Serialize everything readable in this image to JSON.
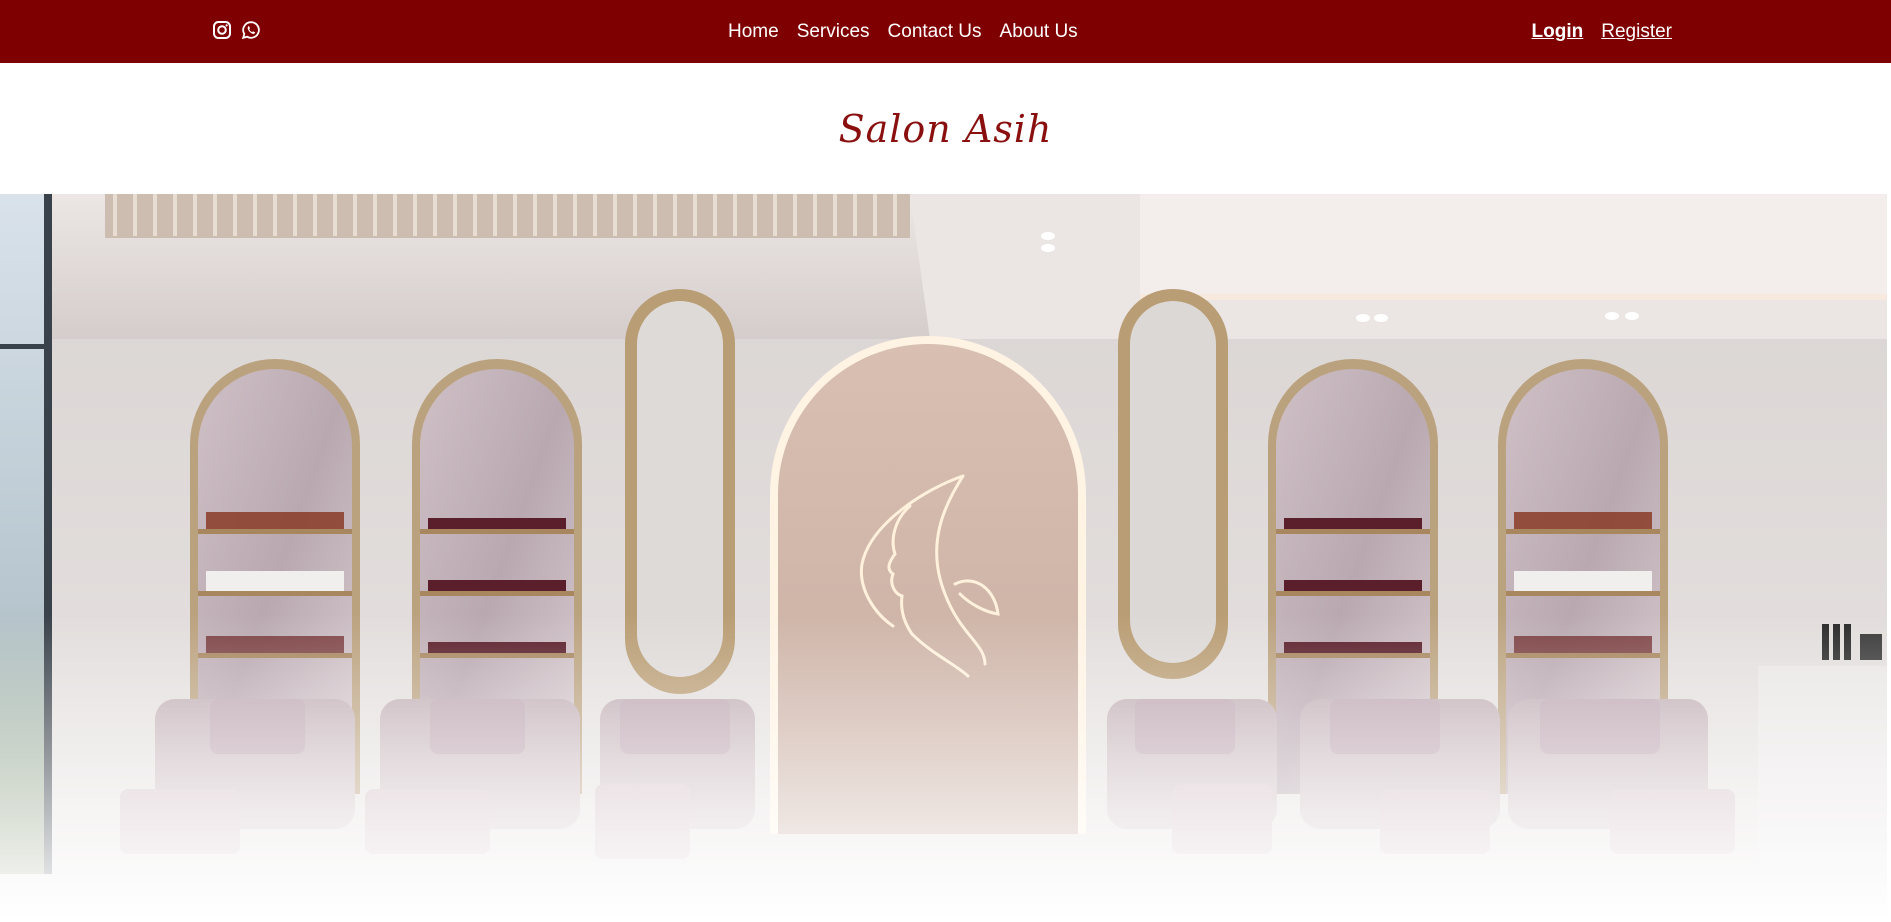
{
  "topbar": {
    "social_icons": [
      "instagram-icon",
      "whatsapp-icon"
    ],
    "nav": [
      "Home",
      "Services",
      "Contact Us",
      "About Us"
    ],
    "login_label": "Login",
    "register_label": "Register",
    "background_color": "#7f0000"
  },
  "brand": {
    "name": "Salon Asih",
    "color": "#8a1010"
  },
  "hero": {
    "description_icon": "salon-interior-image"
  }
}
